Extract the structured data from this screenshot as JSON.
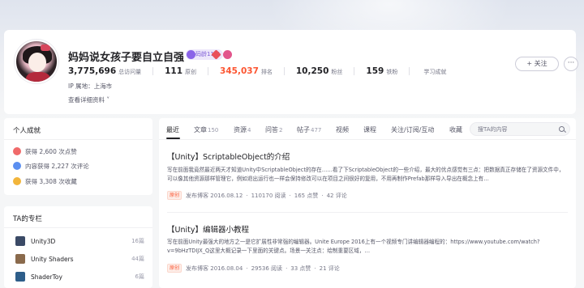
{
  "profile": {
    "username": "妈妈说女孩子要自立自强",
    "years_badge": "码龄11年",
    "stats": [
      {
        "value": "3,775,696",
        "label": "总访问量"
      },
      {
        "value": "111",
        "label": "原创"
      },
      {
        "value": "345,037",
        "label": "排名"
      },
      {
        "value": "10,250",
        "label": "粉丝"
      },
      {
        "value": "159",
        "label": "铁粉"
      },
      {
        "value": "",
        "label": "学习成就"
      }
    ],
    "ip_location": "IP 属地：上海市",
    "detail_link": "查看详细资料",
    "follow_button": "+ 关注",
    "more_button": "···"
  },
  "achievements": {
    "title": "个人成就",
    "items": [
      {
        "text": "获得 2,600 次点赞",
        "icon": "thumbs-up-medal-icon",
        "color": "#f06a6a"
      },
      {
        "text": "内容获得 2,227 次评论",
        "icon": "comment-medal-icon",
        "color": "#5b8ff0"
      },
      {
        "text": "获得 3,308 次收藏",
        "icon": "star-medal-icon",
        "color": "#f2b53b"
      }
    ]
  },
  "columns": {
    "title": "TA的专栏",
    "items": [
      {
        "name": "Unity3D",
        "count": "16篇",
        "color": "#3b4a66"
      },
      {
        "name": "Unity Shaders",
        "count": "44篇",
        "color": "#8a6a4c"
      },
      {
        "name": "ShaderToy",
        "count": "6篇",
        "color": "#2e5e8a"
      }
    ]
  },
  "tabs": [
    {
      "label": "最近",
      "count": ""
    },
    {
      "label": "文章",
      "count": "150"
    },
    {
      "label": "资源",
      "count": "4"
    },
    {
      "label": "问答",
      "count": "2"
    },
    {
      "label": "帖子",
      "count": "477"
    },
    {
      "label": "视频",
      "count": ""
    },
    {
      "label": "课程",
      "count": ""
    },
    {
      "label": "关注/订阅/互动",
      "count": ""
    },
    {
      "label": "收藏",
      "count": ""
    }
  ],
  "search": {
    "placeholder": "搜TA的内容"
  },
  "articles": [
    {
      "title": "【Unity】ScriptableObject的介绍",
      "desc": "写在前面我竟然最近两天才知道Unity中ScriptableObject的存在……看了下ScriptableObject的一些介绍，最大的优点感觉有三点：把数据真正存储在了资源文件中，可以像其他资源那样管理它，例如退出运行也一样会保持修改可以在项目之间很好的复用，不用再制作Prefab那样导入导出在概念上有…",
      "badge": "原创",
      "date": "发布博客 2016.08.12",
      "views": "110170 阅读",
      "likes": "165 点赞",
      "comments": "42 评论"
    },
    {
      "title": "【Unity】编辑器小教程",
      "desc": "写在前面Unity最强大的地方之一是它扩展性非常强的编辑器。Unite Europe 2016上有一个视频专门讲编辑器编程的：https://www.youtube.com/watch?v=9bHzTDIJX_Q这里大概记录一下里面的关键点。场景一关注点：绘制重要区域，…",
      "badge": "原创",
      "date": "发布博客 2016.08.04",
      "views": "29536 阅读",
      "likes": "33 点赞",
      "comments": "21 评论"
    }
  ]
}
